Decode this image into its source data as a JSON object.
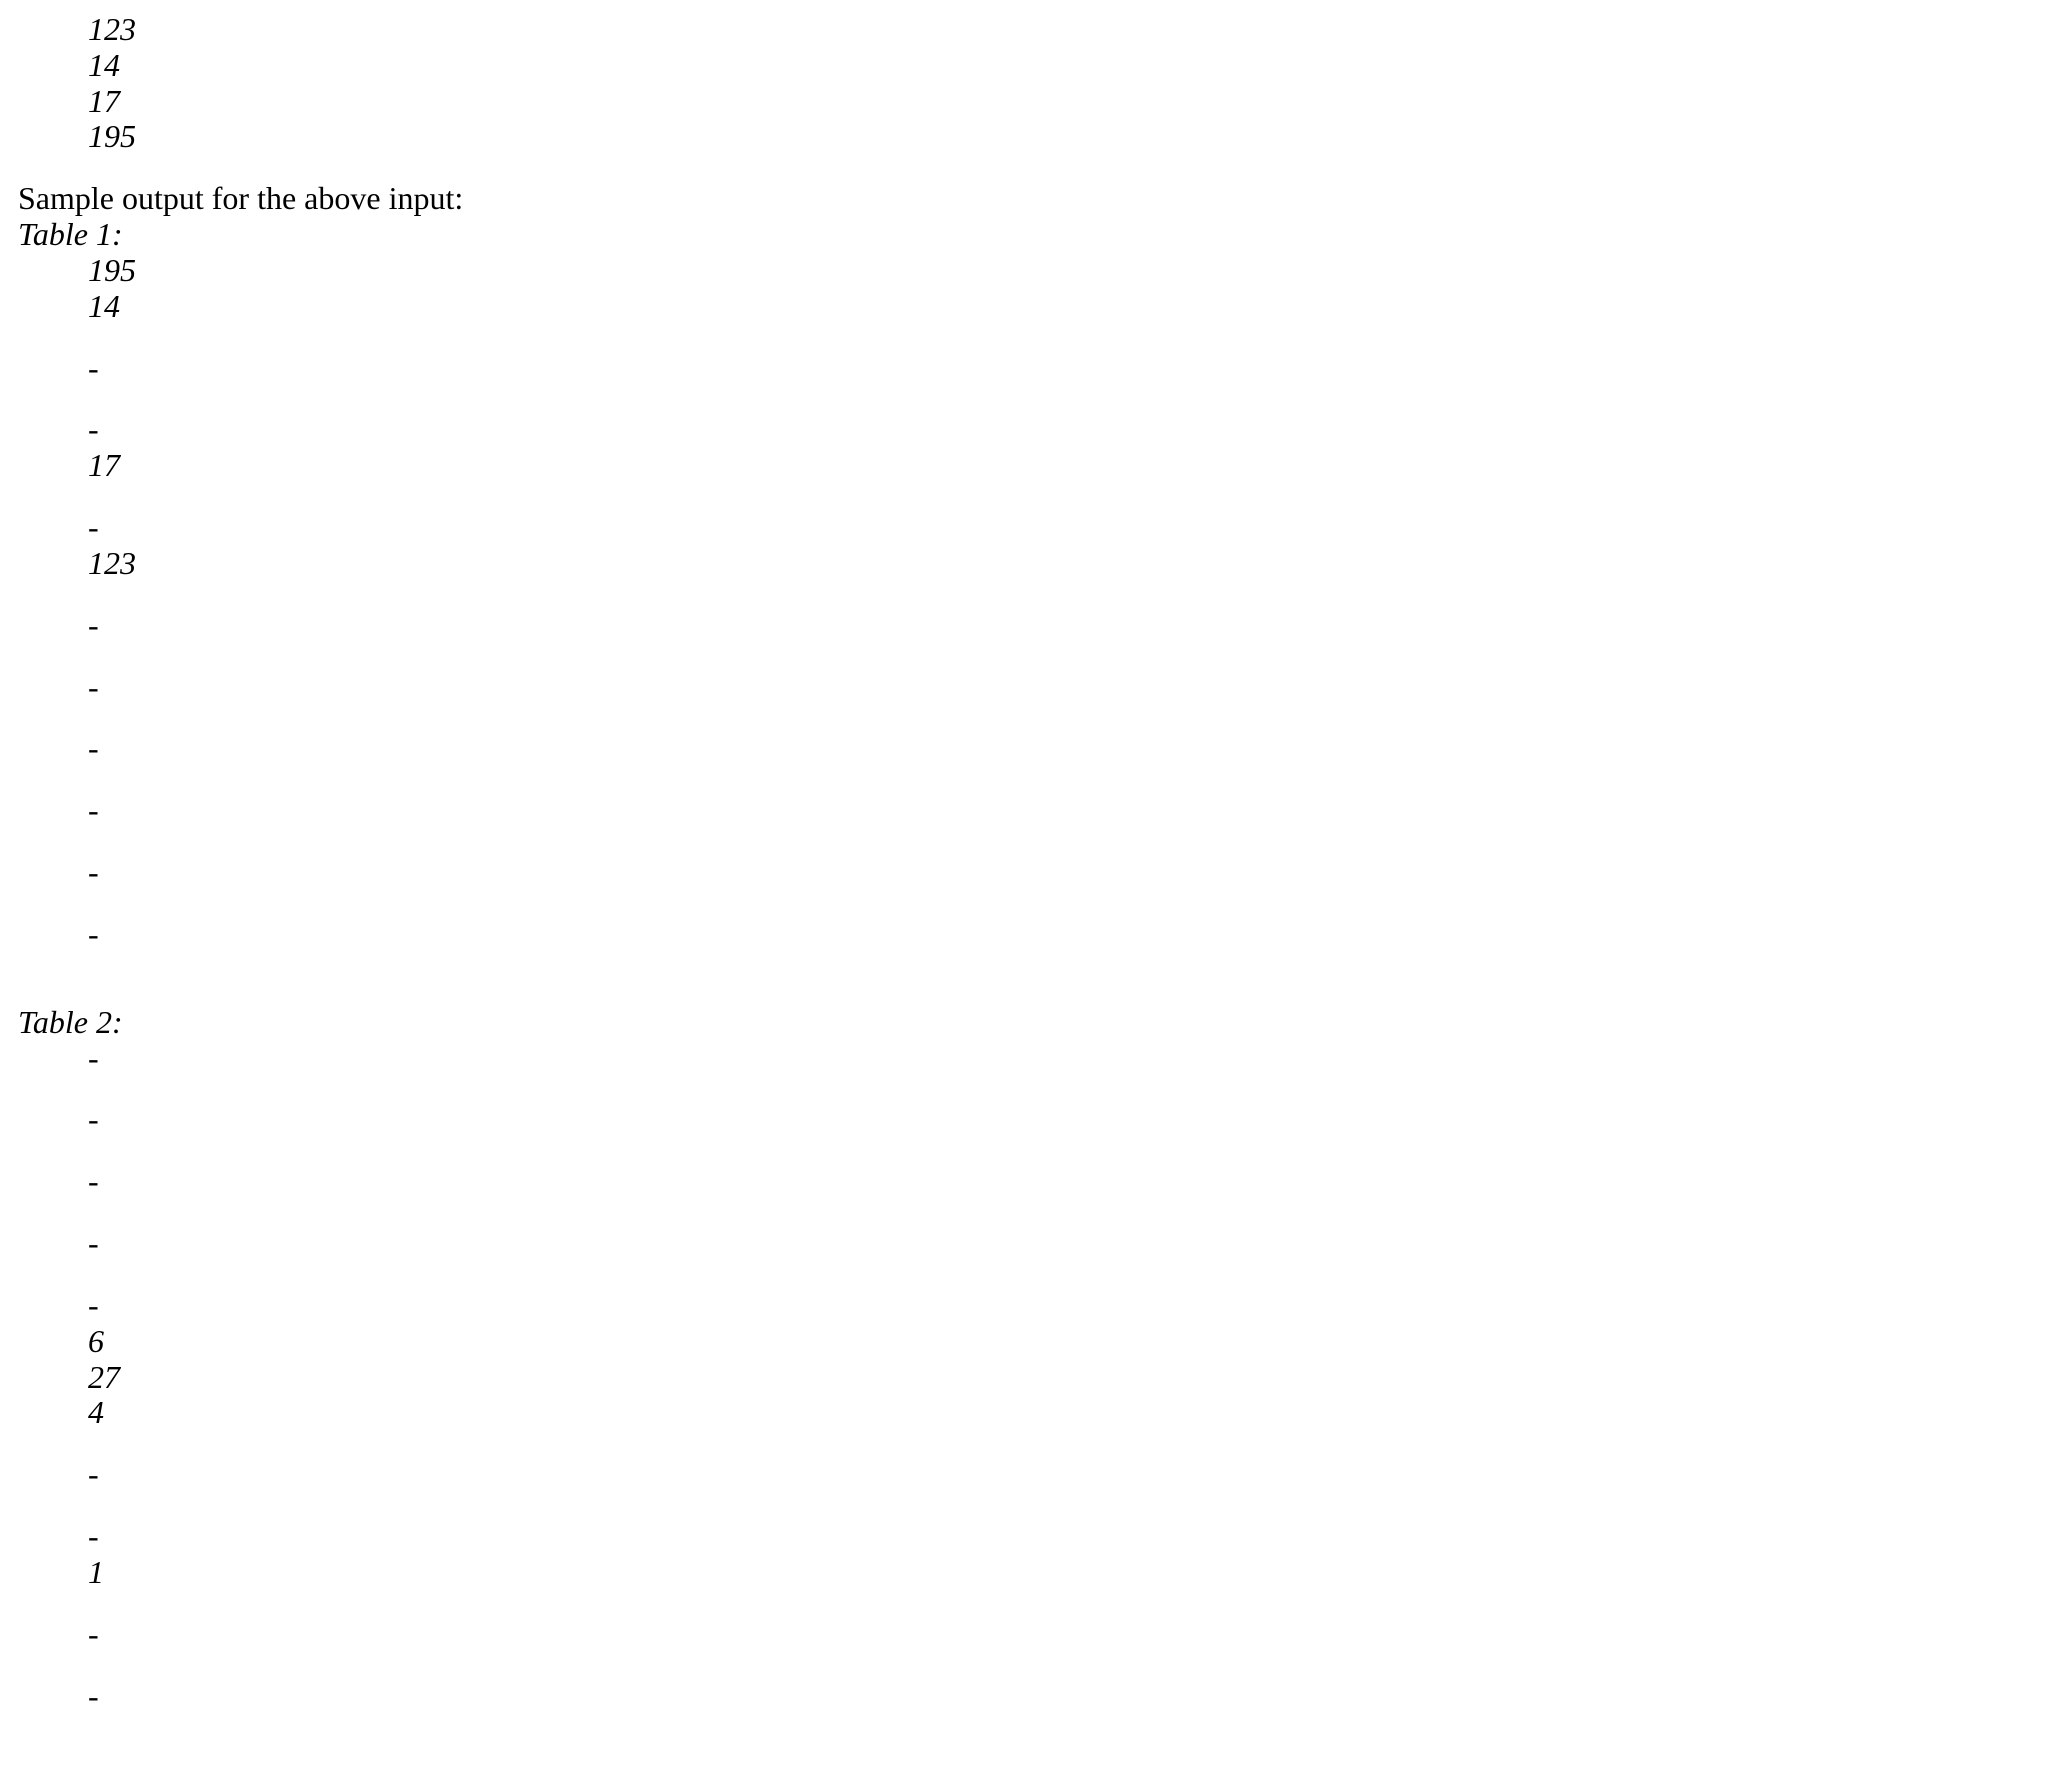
{
  "input_values": [
    "123",
    "14",
    "17",
    "195"
  ],
  "sample_output_label": "Sample output for the above input:",
  "tables": [
    {
      "label": "Table 1:",
      "rows": [
        {
          "value": "195",
          "blank_after": false
        },
        {
          "value": "14",
          "blank_after": true
        },
        {
          "value": "-",
          "blank_after": true
        },
        {
          "value": "-",
          "blank_after": false
        },
        {
          "value": "17",
          "blank_after": true
        },
        {
          "value": "-",
          "blank_after": false
        },
        {
          "value": "123",
          "blank_after": true
        },
        {
          "value": "-",
          "blank_after": true
        },
        {
          "value": "-",
          "blank_after": true
        },
        {
          "value": "-",
          "blank_after": true
        },
        {
          "value": "-",
          "blank_after": true
        },
        {
          "value": "-",
          "blank_after": true
        },
        {
          "value": "-",
          "blank_after": false
        }
      ]
    },
    {
      "label": "Table 2:",
      "rows": [
        {
          "value": "-",
          "blank_after": true
        },
        {
          "value": "-",
          "blank_after": true
        },
        {
          "value": "-",
          "blank_after": true
        },
        {
          "value": "-",
          "blank_after": true
        },
        {
          "value": "-",
          "blank_after": false
        },
        {
          "value": "6",
          "blank_after": false
        },
        {
          "value": "27",
          "blank_after": false
        },
        {
          "value": "4",
          "blank_after": true
        },
        {
          "value": "-",
          "blank_after": true
        },
        {
          "value": "-",
          "blank_after": false
        },
        {
          "value": "1",
          "blank_after": true
        },
        {
          "value": "-",
          "blank_after": true
        },
        {
          "value": "-",
          "blank_after": false
        }
      ]
    }
  ]
}
